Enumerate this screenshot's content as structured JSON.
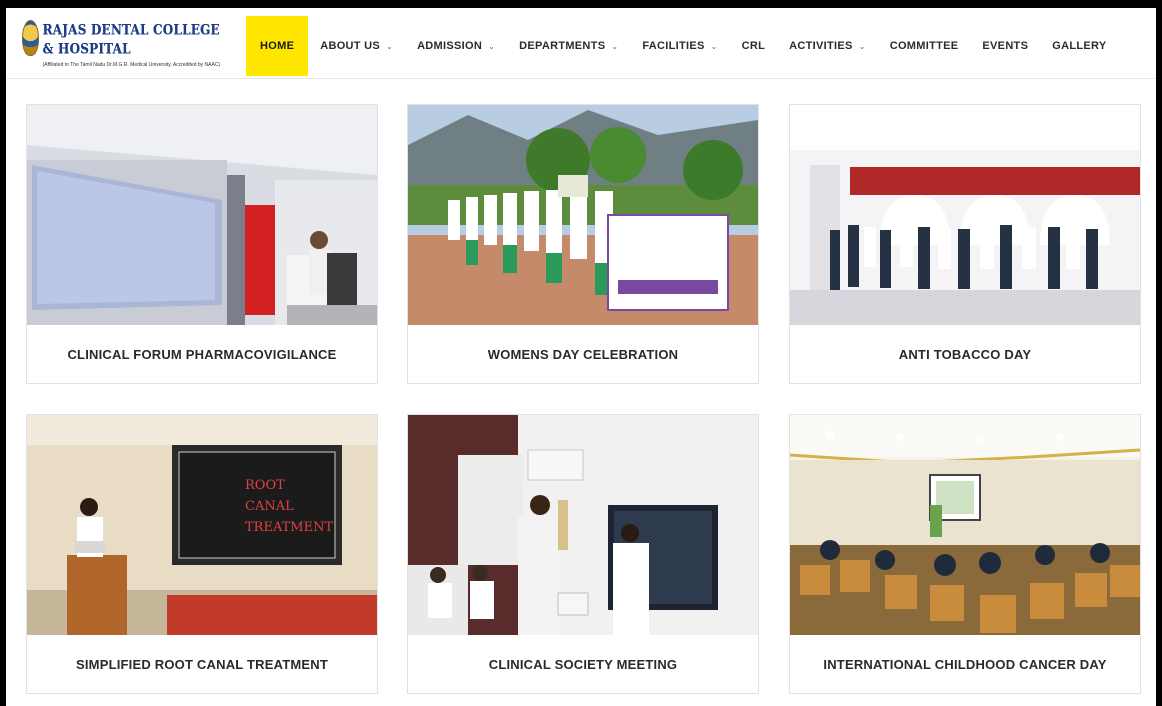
{
  "header": {
    "logo_title": "RAJAS DENTAL COLLEGE & HOSPITAL",
    "logo_subtitle": "(Affiliated to The Tamil Nadu Dr.M.G.R. Medical University, Accredited by NAAC)"
  },
  "nav": [
    {
      "label": "HOME",
      "active": true,
      "has_dropdown": false
    },
    {
      "label": "ABOUT US",
      "active": false,
      "has_dropdown": true
    },
    {
      "label": "ADMISSION",
      "active": false,
      "has_dropdown": true
    },
    {
      "label": "DEPARTMENTS",
      "active": false,
      "has_dropdown": true
    },
    {
      "label": "FACILITIES",
      "active": false,
      "has_dropdown": true
    },
    {
      "label": "CRL",
      "active": false,
      "has_dropdown": false
    },
    {
      "label": "ACTIVITIES",
      "active": false,
      "has_dropdown": true
    },
    {
      "label": "COMMITTEE",
      "active": false,
      "has_dropdown": false
    },
    {
      "label": "EVENTS",
      "active": false,
      "has_dropdown": false
    },
    {
      "label": "GALLERY",
      "active": false,
      "has_dropdown": false
    }
  ],
  "colors": {
    "nav_active_bg": "#ffe600",
    "logo_text": "#1f3c88"
  },
  "cards": [
    {
      "title": "CLINICAL FORUM PHARMACOVIGILANCE"
    },
    {
      "title": "WOMENS DAY CELEBRATION"
    },
    {
      "title": "ANTI TOBACCO DAY"
    },
    {
      "title": "SIMPLIFIED ROOT CANAL TREATMENT"
    },
    {
      "title": "CLINICAL SOCIETY MEETING"
    },
    {
      "title": "INTERNATIONAL CHILDHOOD CANCER DAY"
    }
  ],
  "slides": {
    "root_canal": [
      "ROOT",
      "CANAL",
      "TREATMENT"
    ]
  }
}
